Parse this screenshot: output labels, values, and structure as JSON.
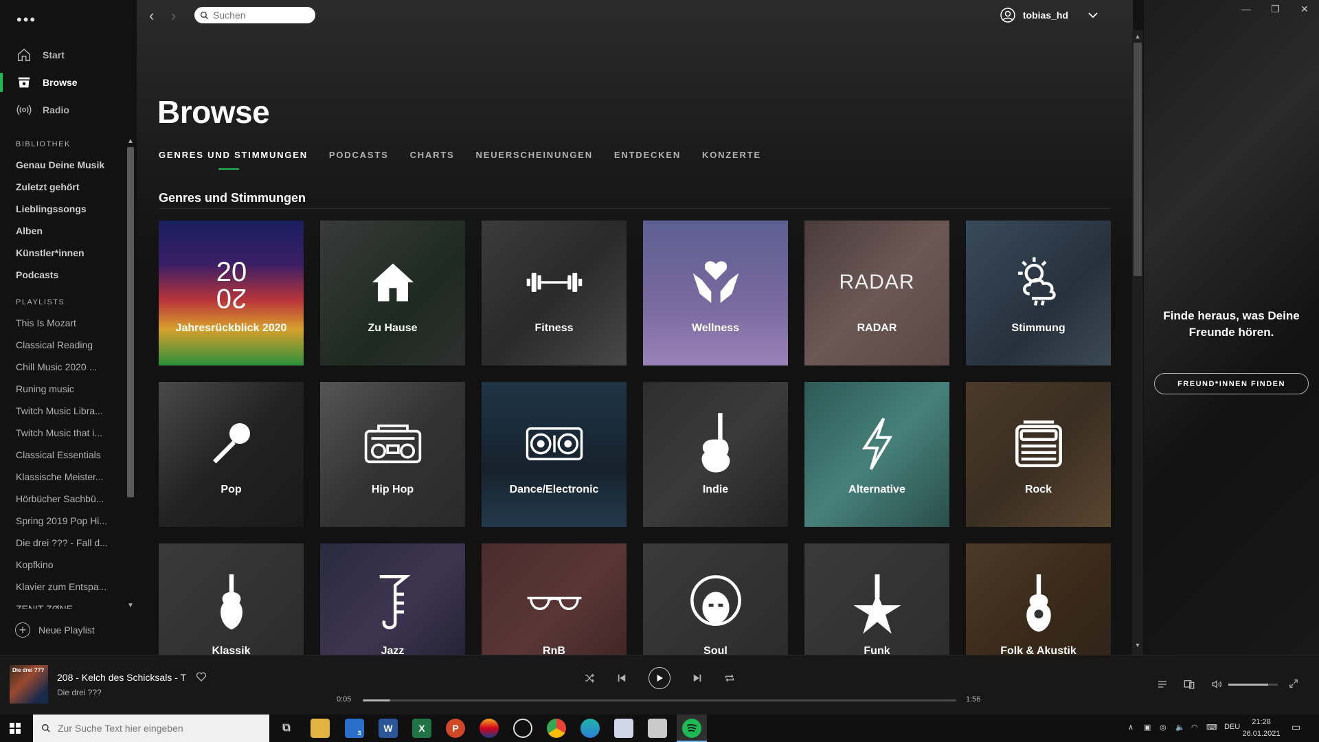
{
  "sidebar": {
    "nav": [
      {
        "label": "Start",
        "icon": "home-icon"
      },
      {
        "label": "Browse",
        "icon": "browse-icon",
        "active": true
      },
      {
        "label": "Radio",
        "icon": "radio-icon"
      }
    ],
    "library_title": "BIBLIOTHEK",
    "library": [
      "Genau Deine Musik",
      "Zuletzt gehört",
      "Lieblingssongs",
      "Alben",
      "Künstler*innen",
      "Podcasts"
    ],
    "playlists_title": "PLAYLISTS",
    "playlists": [
      "This Is Mozart",
      "Classical Reading",
      "Chill Music 2020 ...",
      "Runing music",
      "Twitch Music Libra...",
      "Twitch Music that i...",
      "Classical Essentials",
      "Klassische Meister...",
      "Hörbücher Sachbü...",
      "Spring 2019 Pop Hi...",
      "Die drei ??? - Fall d...",
      "Kopfkino",
      "Klavier zum Entspa...",
      "ZENIT ZØNE"
    ],
    "new_playlist": "Neue Playlist"
  },
  "topbar": {
    "search_placeholder": "Suchen",
    "username": "tobias_hd"
  },
  "main": {
    "title": "Browse",
    "tabs": [
      "GENRES UND STIMMUNGEN",
      "PODCASTS",
      "CHARTS",
      "NEUERSCHEINUNGEN",
      "ENTDECKEN",
      "KONZERTE"
    ],
    "section_title": "Genres und Stimmungen",
    "tiles": [
      {
        "label": "Jahresrückblick 2020",
        "icon": "year-2020-icon",
        "text": "",
        "bg": "linear-gradient(180deg,#1a1f5e 0%,#3a1f66 30%,#b8343a 55%,#d7a02c 75%,#2b8f3a 100%)"
      },
      {
        "label": "Zu Hause",
        "icon": "home-icon",
        "text": "",
        "bg": "linear-gradient(135deg,#3a3a3a,#1e2a22 60%,#2f2f2f)"
      },
      {
        "label": "Fitness",
        "icon": "dumbbell-icon",
        "text": "",
        "bg": "linear-gradient(135deg,#3b3b3b,#2a2a2a 50%,#484848)"
      },
      {
        "label": "Wellness",
        "icon": "wellness-hands-icon",
        "text": "",
        "bg": "linear-gradient(180deg,#5d5f92 0%,#7a6aa0 60%,#9a83b8 100%)"
      },
      {
        "label": "RADAR",
        "icon": "",
        "text": "RADAR",
        "bg": "linear-gradient(135deg,#4a3c3a,#6b5855 50%,#5a4644)"
      },
      {
        "label": "Stimmung",
        "icon": "weather-icon",
        "text": "",
        "bg": "linear-gradient(135deg,#3a4a5a,#26313d 60%,#3c4a55)"
      },
      {
        "label": "Pop",
        "icon": "microphone-icon",
        "text": "",
        "bg": "linear-gradient(135deg,#4a4a4a,#222 50%,#1a1a1a)"
      },
      {
        "label": "Hip Hop",
        "icon": "boombox-icon",
        "text": "",
        "bg": "linear-gradient(135deg,#555,#333 50%,#2a2a2a)"
      },
      {
        "label": "Dance/Electronic",
        "icon": "turntable-icon",
        "text": "",
        "bg": "linear-gradient(180deg,#1f3447 0%,#16222d 60%,#233a4c 100%)"
      },
      {
        "label": "Indie",
        "icon": "guitar-icon",
        "text": "",
        "bg": "linear-gradient(135deg,#2e2e2e,#3a3a3a 50%,#222)"
      },
      {
        "label": "Alternative",
        "icon": "lightning-icon",
        "text": "",
        "bg": "linear-gradient(135deg,#2c5a55,#47807a 50%,#2a4e4a)"
      },
      {
        "label": "Rock",
        "icon": "amplifier-icon",
        "text": "",
        "bg": "linear-gradient(135deg,#4a3a2a,#3a2e22 50%,#5a4630)"
      },
      {
        "label": "Klassik",
        "icon": "violin-icon",
        "text": "",
        "bg": "linear-gradient(135deg,#3a3a3a,#2a2a2a)"
      },
      {
        "label": "Jazz",
        "icon": "saxophone-icon",
        "text": "",
        "bg": "linear-gradient(135deg,#2a2a3e,#3d3550 50%,#1e1e2e)"
      },
      {
        "label": "RnB",
        "icon": "sunglasses-icon",
        "text": "",
        "bg": "linear-gradient(135deg,#4a2c2c,#5a3636 50%,#3a2222)"
      },
      {
        "label": "Soul",
        "icon": "afro-face-icon",
        "text": "",
        "bg": "linear-gradient(135deg,#3a3a3a,#2a2a2a)"
      },
      {
        "label": "Funk",
        "icon": "star-guitar-icon",
        "text": "",
        "bg": "linear-gradient(135deg,#3a3a3a,#2c2c2c)"
      },
      {
        "label": "Folk & Akustik",
        "icon": "acoustic-guitar-icon",
        "text": "",
        "bg": "linear-gradient(135deg,#4a3a2a,#3a2a1a 50%,#2e2218)"
      }
    ]
  },
  "right_panel": {
    "title": "Finde heraus, was Deine Freunde hören.",
    "button": "FREUND*INNEN FINDEN"
  },
  "player": {
    "cover_text": "Die drei ???",
    "track": "208 - Kelch des Schicksals - T",
    "artist": "Die drei ???",
    "elapsed": "0:05",
    "duration": "1:56",
    "progress": 0.046,
    "volume": 0.8
  },
  "taskbar": {
    "search_placeholder": "Zur Suche Text hier eingeben",
    "lang": "DEU",
    "time": "21:28",
    "date": "26.01.2021",
    "mail_badge": "3"
  }
}
